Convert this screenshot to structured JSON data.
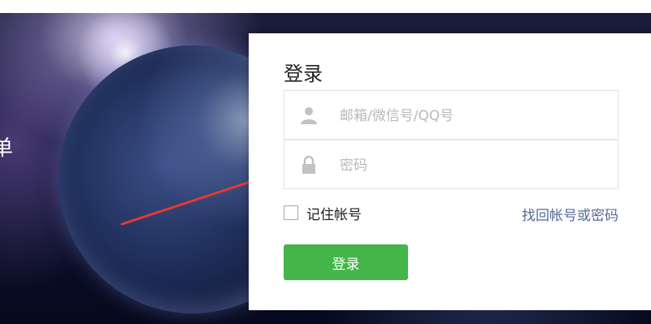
{
  "hero": {
    "partial_char": "单"
  },
  "login": {
    "title": "登录",
    "account": {
      "placeholder": "邮箱/微信号/QQ号",
      "value": "",
      "icon": "user-icon"
    },
    "password": {
      "placeholder": "密码",
      "value": "",
      "icon": "lock-icon"
    },
    "remember_label": "记住帐号",
    "remember_checked": false,
    "forgot_label": "找回帐号或密码",
    "submit_label": "登录"
  },
  "colors": {
    "accent_green": "#44b549",
    "link_blue": "#576b95",
    "annotation_red": "#e53935"
  }
}
